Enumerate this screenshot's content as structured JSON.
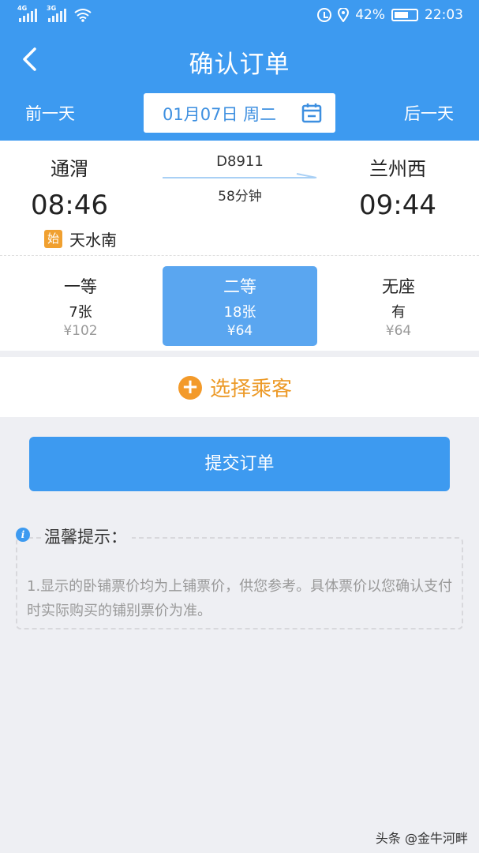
{
  "status_bar": {
    "signal1_label": "4G",
    "signal2_label": "3G",
    "battery": "42%",
    "time": "22:03"
  },
  "header": {
    "title": "确认订单",
    "prev_day": "前一天",
    "next_day": "后一天",
    "date": "01月07日 周二",
    "background_color": "#3d9af0"
  },
  "train": {
    "from_station": "通渭",
    "to_station": "兰州西",
    "departure_time": "08:46",
    "arrival_time": "09:44",
    "train_number": "D8911",
    "duration": "58分钟",
    "origin_badge": "始",
    "origin_station": "天水南"
  },
  "seats": [
    {
      "class": "一等",
      "count": "7张",
      "price": "¥102",
      "selected": false
    },
    {
      "class": "二等",
      "count": "18张",
      "price": "¥64",
      "selected": true
    },
    {
      "class": "无座",
      "count": "有",
      "price": "¥64",
      "selected": false
    }
  ],
  "passenger": {
    "add_label": "选择乘客",
    "accent_color": "#f39a2a"
  },
  "submit": {
    "label": "提交订单"
  },
  "tips": {
    "title": "温馨提示：",
    "text": "1.显示的卧铺票价均为上铺票价，供您参考。具体票价以您确认支付时实际购买的铺别票价为准。"
  },
  "watermark": "头条 @金牛河畔",
  "icons": [
    "back-arrow-icon",
    "calendar-icon",
    "plus-icon",
    "info-icon",
    "alarm-icon",
    "location-icon",
    "battery-icon",
    "wifi-icon"
  ]
}
